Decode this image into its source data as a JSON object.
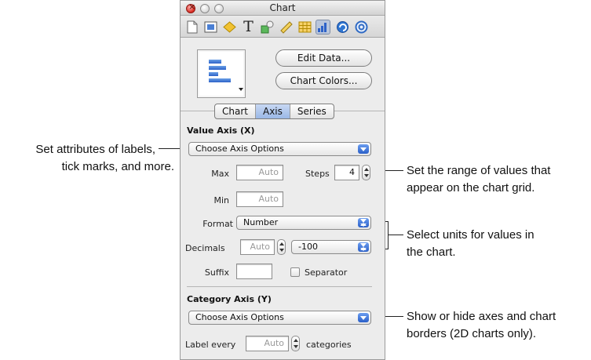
{
  "window": {
    "title": "Chart"
  },
  "toolbar": {
    "tools": [
      {
        "icon": "document-icon"
      },
      {
        "icon": "layout-icon"
      },
      {
        "icon": "graphic-icon"
      },
      {
        "icon": "text-icon",
        "glyph": "T"
      },
      {
        "icon": "shapes-icon"
      },
      {
        "icon": "ruler-icon"
      },
      {
        "icon": "table-icon"
      },
      {
        "icon": "chart-icon",
        "active": true
      },
      {
        "icon": "hyperlink-icon"
      },
      {
        "icon": "quicktime-icon",
        "glyph": "@"
      }
    ]
  },
  "chart_panel": {
    "edit_data_label": "Edit Data...",
    "chart_colors_label": "Chart Colors...",
    "tabs": [
      {
        "label": "Chart"
      },
      {
        "label": "Axis",
        "selected": true
      },
      {
        "label": "Series"
      }
    ]
  },
  "value_axis": {
    "title": "Value Axis (X)",
    "options_popup": "Choose Axis Options",
    "max_label": "Max",
    "max_value": "Auto",
    "steps_label": "Steps",
    "steps_value": "4",
    "min_label": "Min",
    "min_value": "Auto",
    "format_label": "Format",
    "format_value": "Number",
    "decimals_label": "Decimals",
    "decimals_value": "Auto",
    "negative_format": "-100",
    "suffix_label": "Suffix",
    "suffix_value": "",
    "separator_label": "Separator"
  },
  "category_axis": {
    "title": "Category Axis (Y)",
    "options_popup": "Choose Axis Options",
    "label_every_label": "Label every",
    "label_every_value": "Auto",
    "categories_label": "categories"
  },
  "callouts": {
    "labels_line1": "Set attributes of labels,",
    "labels_line2": "tick marks, and more.",
    "range_line1": "Set the range of values that",
    "range_line2": "appear on the chart grid.",
    "units_line1": "Select units for values in",
    "units_line2": "the chart.",
    "axes_line1": "Show or hide axes and chart",
    "axes_line2": "borders (2D charts only)."
  },
  "colors": {
    "accent": "#2d62c8",
    "close_button": "#d9271e"
  }
}
